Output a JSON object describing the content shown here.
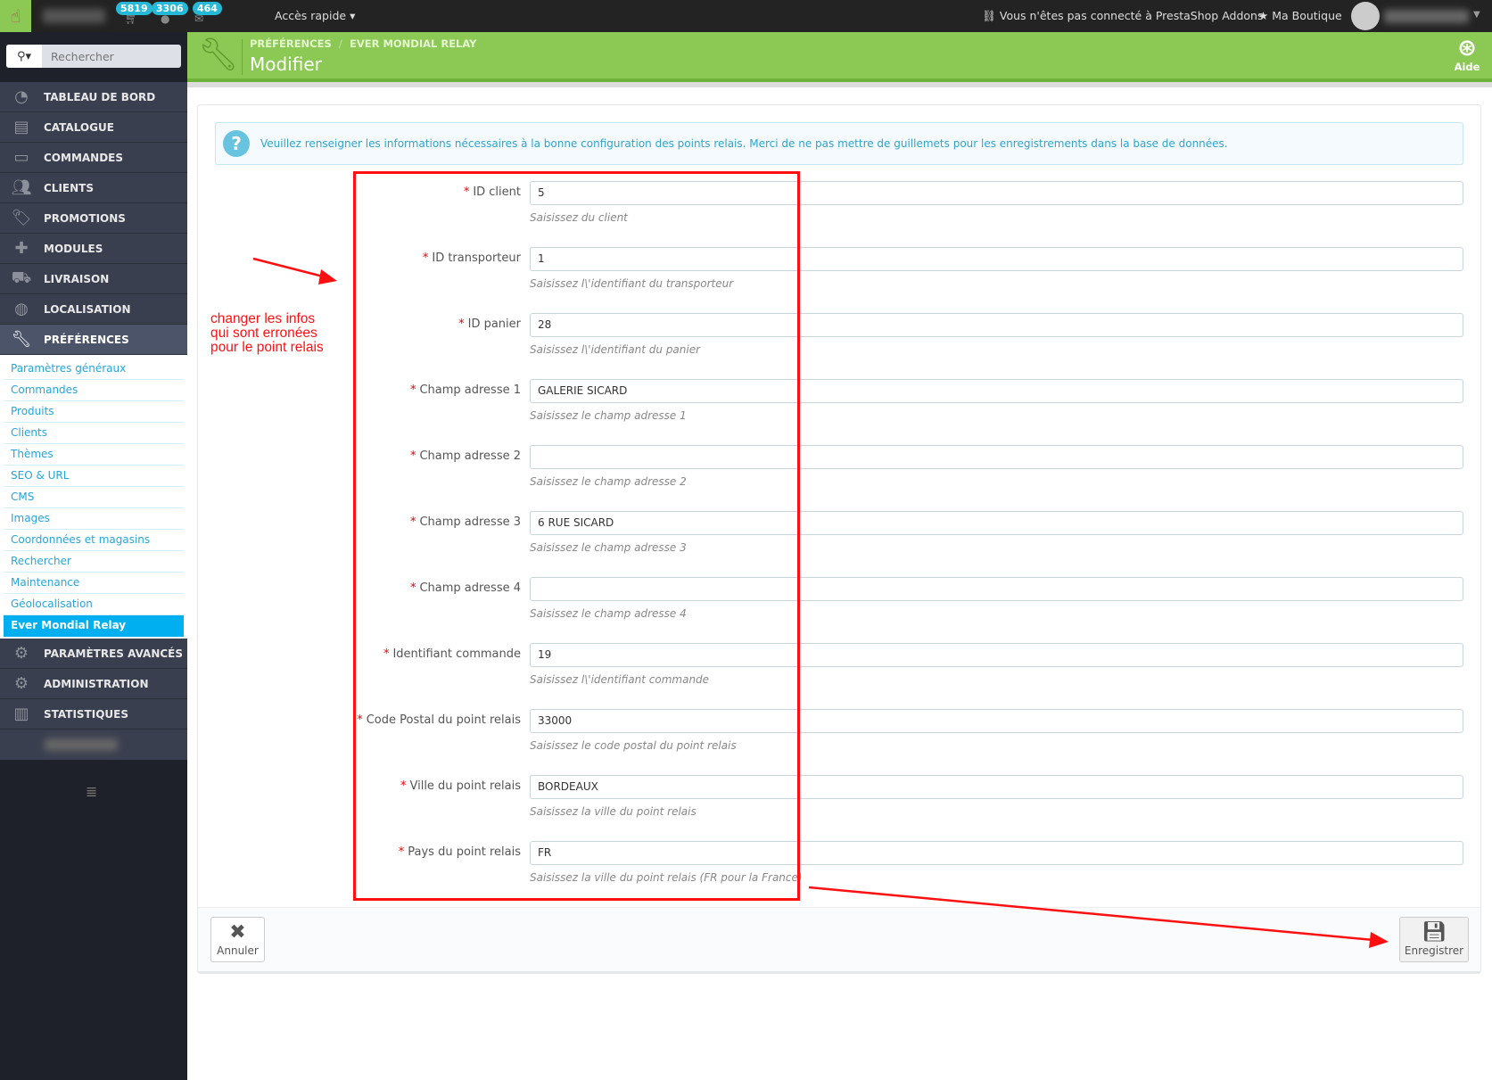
{
  "topbar": {
    "badges": {
      "orders": "5819",
      "customers": "3306",
      "messages": "464"
    },
    "quick_access": "Accès rapide",
    "addons_status": "Vous n'êtes pas connecté à PrestaShop Addons",
    "shop": "Ma Boutique"
  },
  "sidebar": {
    "search_placeholder": "Rechercher",
    "menu": [
      {
        "label": "TABLEAU DE BORD",
        "icon": "dashboard-icon"
      },
      {
        "label": "CATALOGUE",
        "icon": "book-icon"
      },
      {
        "label": "COMMANDES",
        "icon": "credit-card-icon"
      },
      {
        "label": "CLIENTS",
        "icon": "users-icon"
      },
      {
        "label": "PROMOTIONS",
        "icon": "tags-icon"
      },
      {
        "label": "MODULES",
        "icon": "puzzle-icon"
      },
      {
        "label": "LIVRAISON",
        "icon": "truck-icon"
      },
      {
        "label": "LOCALISATION",
        "icon": "globe-icon"
      },
      {
        "label": "PRÉFÉRENCES",
        "icon": "wrench-icon"
      }
    ],
    "submenu": [
      "Paramètres généraux",
      "Commandes",
      "Produits",
      "Clients",
      "Thèmes",
      "SEO & URL",
      "CMS",
      "Images",
      "Coordonnées et magasins",
      "Rechercher",
      "Maintenance",
      "Géolocalisation",
      "Ever Mondial Relay"
    ],
    "menu_bottom": [
      {
        "label": "PARAMÈTRES AVANCÉS",
        "icon": "cogs-icon"
      },
      {
        "label": "ADMINISTRATION",
        "icon": "cog-icon"
      },
      {
        "label": "STATISTIQUES",
        "icon": "bar-chart-icon"
      }
    ]
  },
  "header": {
    "breadcrumb": [
      "PRÉFÉRENCES",
      "EVER MONDIAL RELAY"
    ],
    "breadcrumb_sep": "/",
    "title": "Modifier",
    "help": "Aide",
    "color": "#8bc954"
  },
  "alert": "Veuillez renseigner les informations nécessaires à la bonne configuration des points relais. Merci de ne pas mettre de guillemets pour les enregistrements dans la base de données.",
  "form": {
    "required_mark": "*",
    "fields": [
      {
        "label": "ID client",
        "value": "5",
        "help": "Saisissez du client"
      },
      {
        "label": "ID transporteur",
        "value": "1",
        "help": "Saisissez l\\'identifiant du transporteur"
      },
      {
        "label": "ID panier",
        "value": "28",
        "help": "Saisissez l\\'identifiant du panier"
      },
      {
        "label": "Champ adresse 1",
        "value": "GALERIE SICARD",
        "help": "Saisissez le champ adresse 1"
      },
      {
        "label": "Champ adresse 2",
        "value": "",
        "help": "Saisissez le champ adresse 2"
      },
      {
        "label": "Champ adresse 3",
        "value": "6 RUE SICARD",
        "help": "Saisissez le champ adresse 3"
      },
      {
        "label": "Champ adresse 4",
        "value": "",
        "help": "Saisissez le champ adresse 4"
      },
      {
        "label": "Identifiant commande",
        "value": "19",
        "help": "Saisissez l\\'identifiant commande"
      },
      {
        "label": "Code Postal du point relais",
        "value": "33000",
        "help": "Saisissez le code postal du point relais"
      },
      {
        "label": "Ville du point relais",
        "value": "BORDEAUX",
        "help": "Saisissez la ville du point relais"
      },
      {
        "label": "Pays du point relais",
        "value": "FR",
        "help": "Saisissez la ville du point relais (FR pour la France)"
      }
    ],
    "cancel": "Annuler",
    "save": "Enregistrer"
  },
  "annotation": {
    "lines": [
      "changer les infos",
      "qui sont erronées",
      "pour le point relais"
    ],
    "color": "#ff1010"
  }
}
